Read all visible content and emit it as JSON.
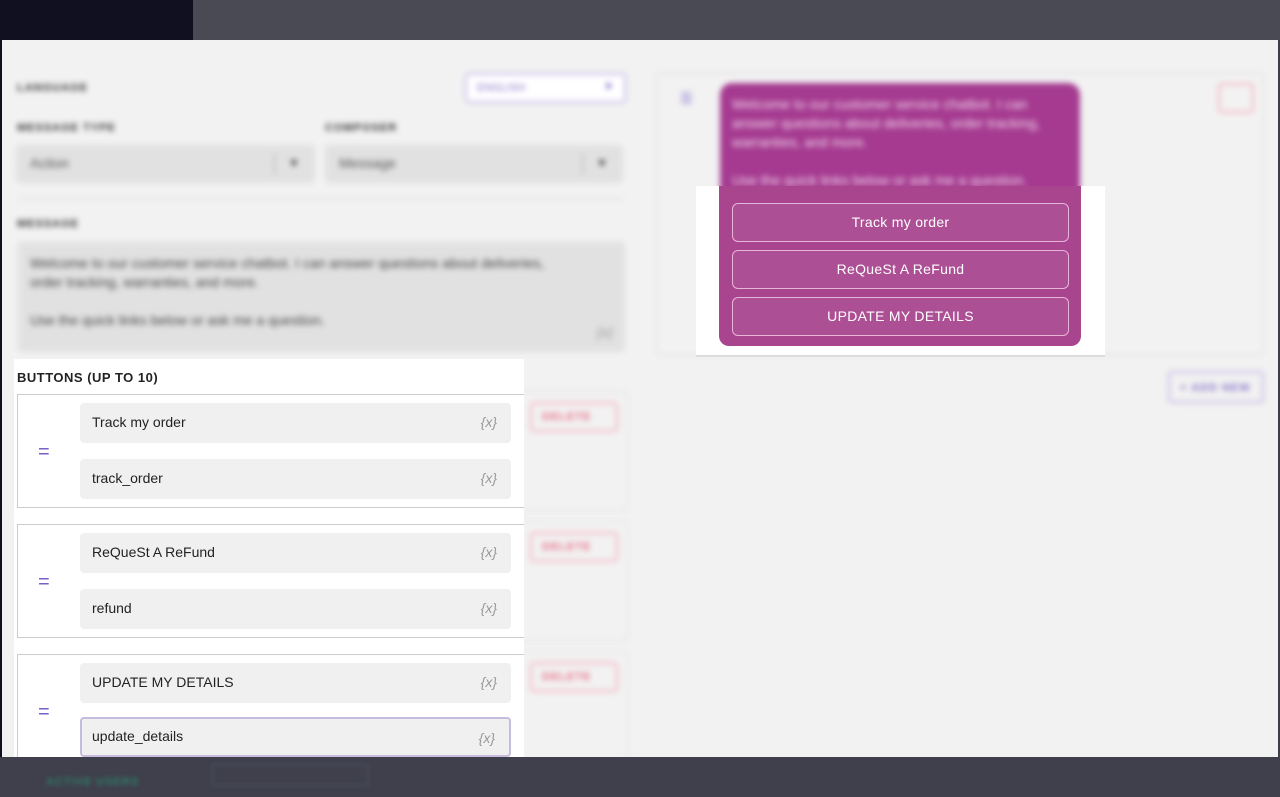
{
  "background": {
    "footer_label": "ACTIVE USERS"
  },
  "editor": {
    "language_label": "LANGUAGE",
    "language_value": "ENGLISH",
    "message_type_label": "MESSAGE TYPE",
    "message_type_value": "Action",
    "composer_label": "COMPOSER",
    "composer_value": "Message",
    "message_label": "MESSAGE",
    "message_line1": "Welcome to our customer service chatbot. I can answer questions about deliveries,",
    "message_line2": "order tracking, warranties, and more.",
    "message_line3": "Use the quick links below or ask me a question.",
    "variable_token": "{x}",
    "delete_label": "DELETE",
    "add_new_label": "+ ADD NEW"
  },
  "buttons": {
    "heading": "BUTTONS (UP TO 10)",
    "items": [
      {
        "label": "Track my order",
        "value": "track_order"
      },
      {
        "label": "ReQueSt A ReFund",
        "value": "refund"
      },
      {
        "label": "UPDATE MY DETAILS",
        "value": "update_details"
      }
    ]
  },
  "preview": {
    "bubble_line1": "Welcome to our customer service chatbot. I can",
    "bubble_line2": "answer questions about deliveries, order tracking,",
    "bubble_line3": "warranties, and more.",
    "bubble_line4": "Use the quick links below or ask me a question.",
    "chat_buttons": [
      "Track my order",
      "ReQueSt A ReFund",
      "UPDATE MY DETAILS"
    ]
  },
  "colors": {
    "accent_purple": "#7a5fc9",
    "bubble_magenta": "#a9458f",
    "delete_red": "#e76a85"
  }
}
